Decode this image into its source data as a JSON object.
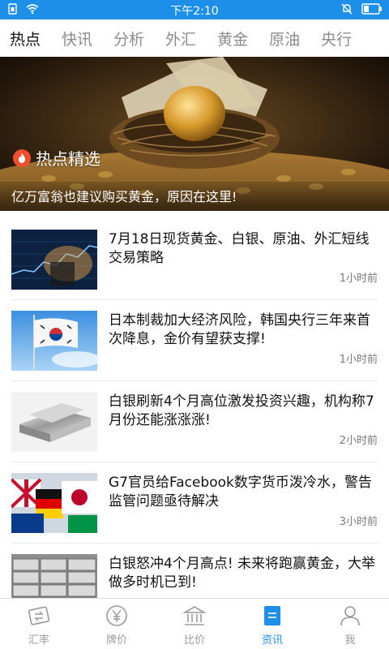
{
  "status_bar": {
    "time": "下午2:10"
  },
  "tabs": [
    {
      "label": "热点",
      "active": true
    },
    {
      "label": "快讯",
      "active": false
    },
    {
      "label": "分析",
      "active": false
    },
    {
      "label": "外汇",
      "active": false
    },
    {
      "label": "黄金",
      "active": false
    },
    {
      "label": "原油",
      "active": false
    },
    {
      "label": "央行",
      "active": false
    }
  ],
  "hero": {
    "badge_label": "热点精选",
    "caption": "亿万富翁也建议购买黄金，原因在这里!"
  },
  "news": [
    {
      "title": "7月18日现货黄金、白银、原油、外汇短线交易策略",
      "time": "1小时前",
      "thumb": "chart-thumb"
    },
    {
      "title": "日本制裁加大经济风险，韩国央行三年来首次降息，金价有望获支撑!",
      "time": "1小时前",
      "thumb": "flag-thumb"
    },
    {
      "title": "白银刷新4个月高位激发投资兴趣，机构称7月份还能涨涨涨!",
      "time": "2小时前",
      "thumb": "silver-bar-thumb"
    },
    {
      "title": "G7官员给Facebook数字货币泼冷水，警告监管问题亟待解决",
      "time": "3小时前",
      "thumb": "flags-thumb"
    },
    {
      "title": "白银怒冲4个月高点! 未来将跑赢黄金，大举做多时机已到!",
      "time": "",
      "thumb": "silver-stack-thumb"
    }
  ],
  "bottom_nav": [
    {
      "label": "汇率",
      "icon": "exchange-icon",
      "active": false
    },
    {
      "label": "牌价",
      "icon": "yen-coin-icon",
      "active": false
    },
    {
      "label": "比价",
      "icon": "bank-icon",
      "active": false
    },
    {
      "label": "资讯",
      "icon": "news-icon",
      "active": true
    },
    {
      "label": "我",
      "icon": "person-icon",
      "active": false
    }
  ],
  "colors": {
    "accent": "#1e8fe8",
    "fire": "#ef4f2f"
  }
}
